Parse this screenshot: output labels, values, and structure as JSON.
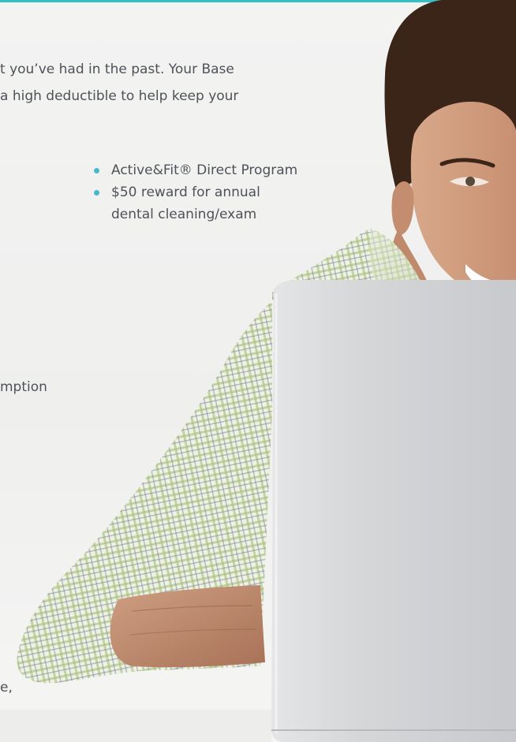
{
  "colors": {
    "accent": "#35bfc6",
    "bullet": "#48b9c8",
    "text": "#4e5258"
  },
  "intro": {
    "line1": "t you’ve had in the past. Your Base",
    "line2": "a high deductible to help keep your"
  },
  "benefits": [
    {
      "label": "Active&Fit® Direct Program",
      "label2": ""
    },
    {
      "label": "$50 reward for annual",
      "label2": "dental cleaning/exam"
    }
  ],
  "fragments": {
    "a": "mption",
    "b": "e,"
  },
  "photo": {
    "icon": "man-with-laptop-photo"
  }
}
